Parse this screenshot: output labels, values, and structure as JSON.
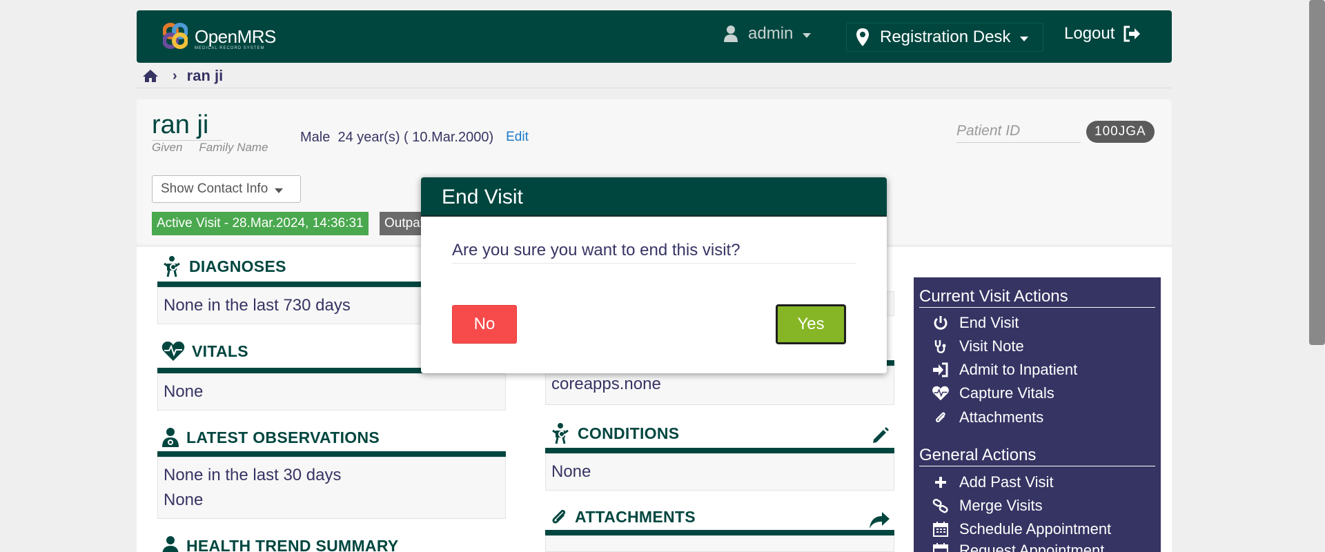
{
  "header": {
    "logo_text": "OpenMRS",
    "logo_sub": "MEDICAL RECORD SYSTEM",
    "user": "admin",
    "location": "Registration Desk",
    "logout": "Logout"
  },
  "breadcrumb": {
    "current": "ran ji"
  },
  "patient": {
    "name": "ran ji",
    "given_label": "Given",
    "family_label": "Family Name",
    "info": "Male  24 year(s) ( 10.Mar.2000)",
    "edit_label": "Edit",
    "id_label": "Patient ID",
    "id_value": "100JGA",
    "contact_btn": "Show Contact Info",
    "active_visit": "Active Visit - 28.Mar.2024, 14:36:31",
    "visit_type": "Outpatient"
  },
  "left_col": {
    "diagnoses_title": "DIAGNOSES",
    "diagnoses_body": "None in the last 730 days",
    "vitals_title": "VITALS",
    "vitals_body": "None",
    "obs_title": "LATEST OBSERVATIONS",
    "obs_body_1": "None in the last 30 days",
    "obs_body_2": "None",
    "trend_title": "HEALTH TREND SUMMARY"
  },
  "mid_col": {
    "coreapps_body": "coreapps.none",
    "conditions_title": "CONDITIONS",
    "conditions_body": "None",
    "attachments_title": "ATTACHMENTS"
  },
  "sidebar": {
    "current_head": "Current Visit Actions",
    "current_items": [
      "End Visit",
      "Visit Note",
      "Admit to Inpatient",
      "Capture Vitals",
      "Attachments"
    ],
    "general_head": "General Actions",
    "general_items": [
      "Add Past Visit",
      "Merge Visits",
      "Schedule Appointment",
      "Request Appointment"
    ]
  },
  "modal": {
    "title": "End Visit",
    "question": "Are you sure you want to end this visit?",
    "no_label": "No",
    "yes_label": "Yes"
  },
  "colors": {
    "primary": "#00463f",
    "sidebar": "#363463",
    "active_visit": "#4aa84e",
    "no_button": "#f74b4b",
    "yes_button": "#86b625"
  }
}
